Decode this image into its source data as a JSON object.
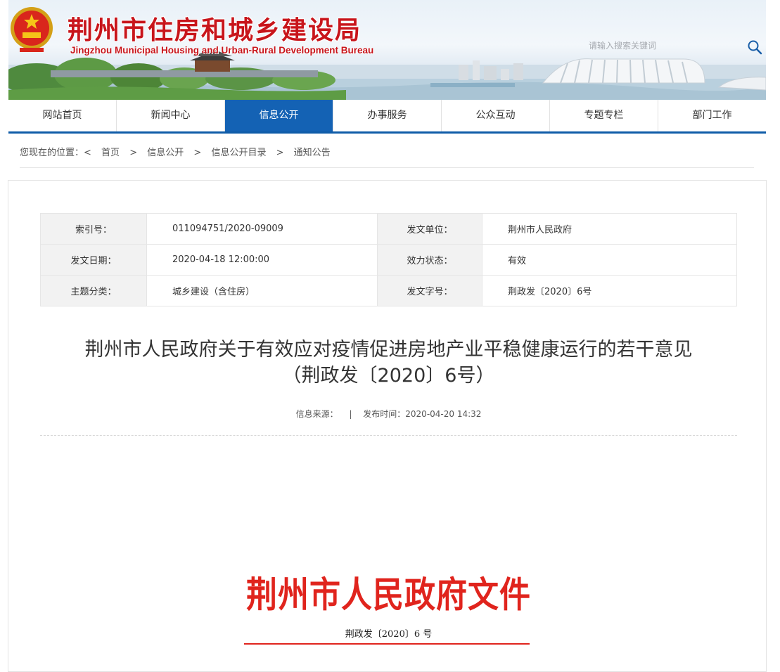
{
  "header": {
    "title": "荆州市住房和城乡建设局",
    "subtitle": "Jingzhou Municipal Housing and Urban-Rural Development Bureau",
    "search_placeholder": "请输入搜索关键词",
    "emblem_icon": "national-emblem-icon",
    "search_icon": "search-icon"
  },
  "nav": {
    "items": [
      "网站首页",
      "新闻中心",
      "信息公开",
      "办事服务",
      "公众互动",
      "专题专栏",
      "部门工作"
    ],
    "active_index": 2
  },
  "breadcrumb": {
    "prefix": "您现在的位置：<",
    "items": [
      "首页",
      "信息公开",
      "信息公开目录",
      "通知公告"
    ],
    "separator": ">"
  },
  "meta": {
    "rows": [
      {
        "k1": "索引号：",
        "v1": "011094751/2020-09009",
        "k2": "发文单位：",
        "v2": "荆州市人民政府"
      },
      {
        "k1": "发文日期：",
        "v1": "2020-04-18 12:00:00",
        "k2": "效力状态：",
        "v2": "有效"
      },
      {
        "k1": "主题分类：",
        "v1": "城乡建设（含住房）",
        "k2": "发文字号：",
        "v2": "荆政发〔2020〕6号"
      }
    ]
  },
  "article": {
    "title_line1": "荆州市人民政府关于有效应对疫情促进房地产业平稳健康运行的若干意见",
    "title_line2": "（荆政发〔2020〕6号）",
    "source_label": "信息来源：",
    "info_sep": "|",
    "publish_label": "发布时间：2020-04-20 14:32",
    "redhead": "荆州市人民政府文件",
    "doc_number": "荆政发〔2020〕6 号"
  },
  "colors": {
    "brand_red": "#c8151b",
    "nav_blue": "#1462b4",
    "redhead": "#e0241d"
  }
}
